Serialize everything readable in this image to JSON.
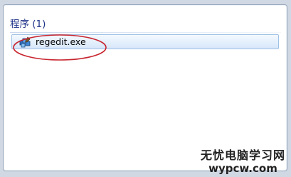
{
  "search_results": {
    "group_label": "程序 (1)",
    "items": [
      {
        "label": "regedit.exe",
        "icon": "regedit-icon"
      }
    ]
  },
  "annotation": {
    "color": "#c8252f"
  },
  "watermark": {
    "title": "无忧电脑学习网",
    "url": "wypcw.com"
  }
}
